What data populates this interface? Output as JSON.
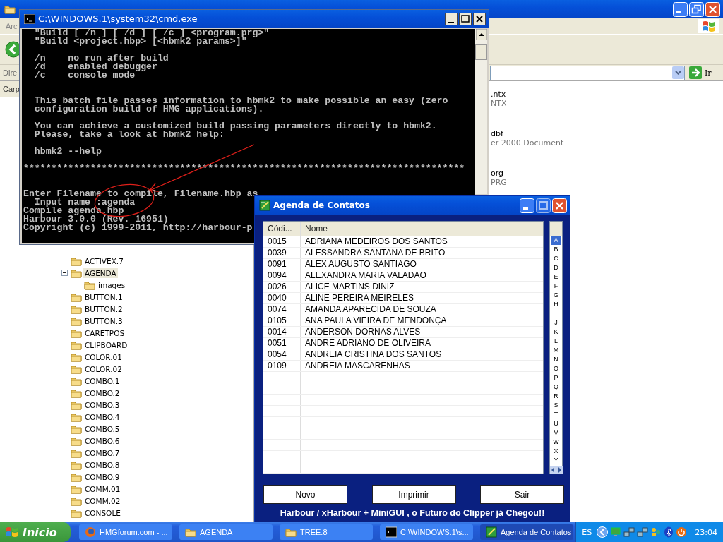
{
  "explorer": {
    "menu_text": "Arc",
    "address_label": "Dire",
    "go_button": "Ir",
    "pane_label": "Carp",
    "tree": [
      {
        "label": "ACTIVEX.7",
        "selected": false
      },
      {
        "label": "AGENDA",
        "selected": true,
        "expanded": true,
        "children": [
          {
            "label": "images",
            "selected": false
          }
        ]
      },
      {
        "label": "BUTTON.1",
        "selected": false
      },
      {
        "label": "BUTTON.2",
        "selected": false
      },
      {
        "label": "BUTTON.3",
        "selected": false
      },
      {
        "label": "CARETPOS",
        "selected": false
      },
      {
        "label": "CLIPBOARD",
        "selected": false
      },
      {
        "label": "COLOR.01",
        "selected": false
      },
      {
        "label": "COLOR.02",
        "selected": false
      },
      {
        "label": "COMBO.1",
        "selected": false
      },
      {
        "label": "COMBO.2",
        "selected": false
      },
      {
        "label": "COMBO.3",
        "selected": false
      },
      {
        "label": "COMBO.4",
        "selected": false
      },
      {
        "label": "COMBO.5",
        "selected": false
      },
      {
        "label": "COMBO.6",
        "selected": false
      },
      {
        "label": "COMBO.7",
        "selected": false
      },
      {
        "label": "COMBO.8",
        "selected": false
      },
      {
        "label": "COMBO.9",
        "selected": false
      },
      {
        "label": "COMM.01",
        "selected": false
      },
      {
        "label": "COMM.02",
        "selected": false
      },
      {
        "label": "CONSOLE",
        "selected": false
      }
    ],
    "files": [
      {
        "name": ".ntx",
        "type": "NTX"
      },
      {
        "name": "dbf",
        "type": "er 2000 Document"
      },
      {
        "name": "org",
        "type": "PRG"
      }
    ]
  },
  "console_window": {
    "title": "C:\\WINDOWS.1\\system32\\cmd.exe",
    "blocks": [
      {
        "lines": [
          "  \"Build [ /n ] [ /d ] [ /c ] <program.prg>\"",
          "  \"Build <project.hbp> [<hbmk2 params>]\""
        ],
        "kind": "paragraph"
      },
      {
        "lines": [
          "  /n    no run after build",
          "  /d    enabled debugger",
          "  /c    console mode"
        ],
        "kind": "section"
      },
      {
        "lines": [
          "  This batch file passes information to hbmk2 to make possible an easy (zero",
          "  configuration build of HMG applications)."
        ],
        "kind": "paragraph"
      },
      {
        "lines": [
          "  You can achieve a customized build passing parameters directly to hbmk2.",
          "  Please, take a look at hbmk2 help:"
        ],
        "kind": "paragraph"
      },
      {
        "lines": [
          "  hbmk2 --help"
        ],
        "kind": "paragraph"
      },
      {
        "lines": [
          "*******************************************************************************"
        ],
        "kind": "section"
      },
      {
        "lines": [
          "Enter Filename to compile, Filename.hbp as",
          "  Input name :agenda",
          "Compile agenda.hbp",
          "Harbour 3.0.0 (Rev. 16951)",
          "Copyright (c) 1999-2011, http://harbour-p"
        ],
        "kind": "tail"
      }
    ]
  },
  "agenda_window": {
    "title": "Agenda de Contatos",
    "columns": [
      "Códi...",
      "Nome"
    ],
    "rows": [
      {
        "code": "0015",
        "name": "ADRIANA MEDEIROS DOS SANTOS"
      },
      {
        "code": "0039",
        "name": "ALESSANDRA SANTANA DE BRITO"
      },
      {
        "code": "0091",
        "name": "ALEX AUGUSTO SANTIAGO"
      },
      {
        "code": "0094",
        "name": "ALEXANDRA MARIA VALADAO"
      },
      {
        "code": "0026",
        "name": "ALICE MARTINS DINIZ"
      },
      {
        "code": "0040",
        "name": "ALINE PEREIRA MEIRELES"
      },
      {
        "code": "0074",
        "name": "AMANDA APARECIDA DE SOUZA"
      },
      {
        "code": "0105",
        "name": "ANA PAULA VIEIRA DE MENDONÇA"
      },
      {
        "code": "0014",
        "name": "ANDERSON DORNAS ALVES"
      },
      {
        "code": "0051",
        "name": "ANDRE ADRIANO DE OLIVEIRA"
      },
      {
        "code": "0054",
        "name": "ANDREIA CRISTINA DOS SANTOS"
      },
      {
        "code": "0109",
        "name": "ANDREIA MASCARENHAS"
      }
    ],
    "letters": [
      {
        "letter": "A",
        "selected": true
      },
      {
        "letter": "B",
        "selected": false
      },
      {
        "letter": "C",
        "selected": false
      },
      {
        "letter": "D",
        "selected": false
      },
      {
        "letter": "E",
        "selected": false
      },
      {
        "letter": "F",
        "selected": false
      },
      {
        "letter": "G",
        "selected": false
      },
      {
        "letter": "H",
        "selected": false
      },
      {
        "letter": "I",
        "selected": false
      },
      {
        "letter": "J",
        "selected": false
      },
      {
        "letter": "K",
        "selected": false
      },
      {
        "letter": "L",
        "selected": false
      },
      {
        "letter": "M",
        "selected": false
      },
      {
        "letter": "N",
        "selected": false
      },
      {
        "letter": "O",
        "selected": false
      },
      {
        "letter": "P",
        "selected": false
      },
      {
        "letter": "Q",
        "selected": false
      },
      {
        "letter": "R",
        "selected": false
      },
      {
        "letter": "S",
        "selected": false
      },
      {
        "letter": "T",
        "selected": false
      },
      {
        "letter": "U",
        "selected": false
      },
      {
        "letter": "V",
        "selected": false
      },
      {
        "letter": "W",
        "selected": false
      },
      {
        "letter": "X",
        "selected": false
      },
      {
        "letter": "Y",
        "selected": false
      }
    ],
    "buttons": [
      "Novo",
      "Imprimir",
      "Sair"
    ],
    "footer": "Harbour / xHarbour + MiniGUI , o Futuro do Clipper já Chegou!!"
  },
  "taskbar": {
    "start": "Inicio",
    "tasks": [
      {
        "label": "HMGforum.com - ...",
        "kind": "browser",
        "selected": false
      },
      {
        "label": "AGENDA",
        "kind": "folder",
        "selected": false
      },
      {
        "label": "TREE.8",
        "kind": "folder",
        "selected": false
      },
      {
        "label": "C:\\WINDOWS.1\\s...",
        "kind": "console",
        "selected": false
      },
      {
        "label": "Agenda de Contatos",
        "kind": "app",
        "selected": true
      }
    ],
    "language": "ES",
    "clock": "23:04"
  }
}
